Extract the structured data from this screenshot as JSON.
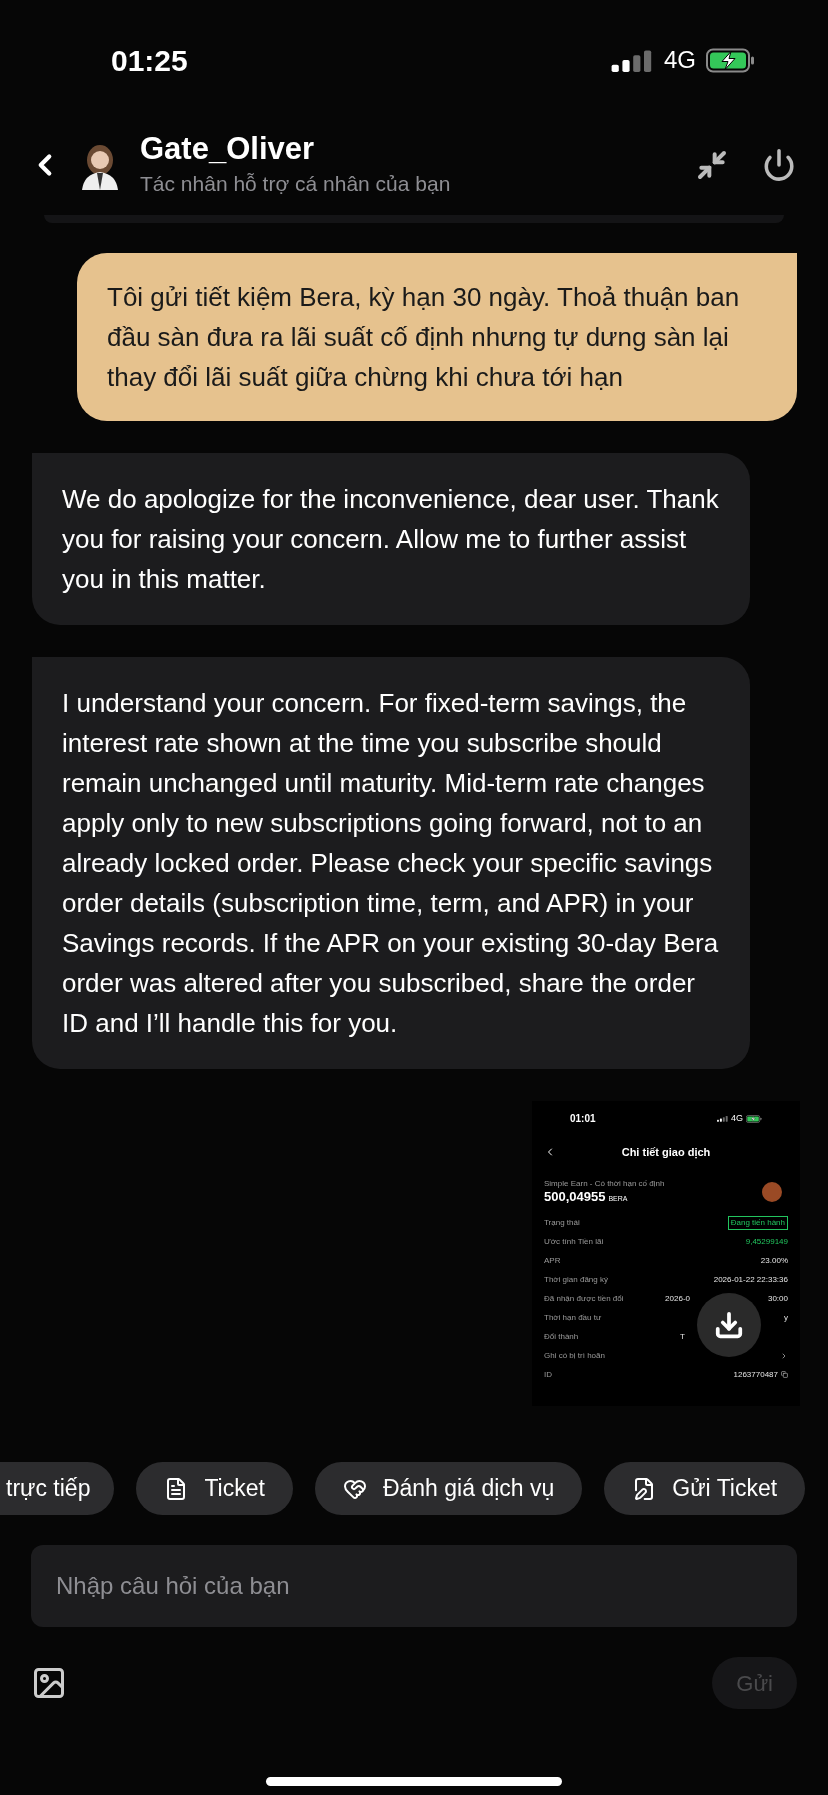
{
  "status_bar": {
    "time": "01:25",
    "network": "4G"
  },
  "header": {
    "title": "Gate_Oliver",
    "subtitle": "Tác nhân hỗ trợ cá nhân của bạn"
  },
  "messages": [
    {
      "kind": "user",
      "text": "Tôi gửi tiết kiệm Bera, kỳ hạn 30 ngày. Thoả thuận ban đầu sàn đưa ra lãi suất cố định nhưng tự dưng sàn lại thay đổi lãi suất giữa chừng khi chưa tới hạn"
    },
    {
      "kind": "bot",
      "text": "We do apologize for the inconvenience, dear user. Thank you for raising your concern. Allow me to further assist you in this matter."
    },
    {
      "kind": "bot",
      "text": "I understand your concern. For fixed-term savings, the interest rate shown at the time you subscribe should remain unchanged until maturity. Mid-term rate changes apply only to new subscriptions going forward, not to an already locked order. Please check your specific savings order details (subscription time, term, and APR) in your Savings records. If the APR on your existing 30-day Bera order was altered after you subscribed, share the order ID and I’ll handle this for you."
    },
    {
      "kind": "screenshot",
      "time": "01:01",
      "network": "4G",
      "title": "Chi tiết giao dịch",
      "product": "Simple Earn - Có thời hạn cố định",
      "amount": "500,04955",
      "unit": "BERA",
      "rows": [
        {
          "label": "Trạng thái",
          "value": "Đang tiến hành",
          "kind": "badge"
        },
        {
          "label": "Ước tính Tiền lãi",
          "value": "9,45299149",
          "kind": "green"
        },
        {
          "label": "APR",
          "value": "23.00%",
          "kind": "plain"
        },
        {
          "label": "Thời gian đăng ký",
          "value": "2026-01-22 22:33:36",
          "kind": "plain"
        },
        {
          "label": "Đã nhận được tiền đổi",
          "value": "2026-0",
          "value_end": "30:00",
          "kind": "plain"
        },
        {
          "label": "Thời hạn đầu tư",
          "value_end": "y",
          "kind": "plain"
        },
        {
          "label": "Đổi thành",
          "value": "T",
          "kind": "plain"
        },
        {
          "label": "Ghi có bị trì hoãn",
          "kind": "chevron"
        },
        {
          "label": "ID",
          "value": "1263770487",
          "kind": "copy"
        }
      ]
    }
  ],
  "quick_actions": [
    {
      "label": "trực tiếp"
    },
    {
      "label": "Ticket"
    },
    {
      "label": "Đánh giá dịch vụ"
    },
    {
      "label": "Gửi Ticket"
    }
  ],
  "input": {
    "placeholder": "Nhập câu hỏi của bạn"
  },
  "send_button": {
    "label": "Gửi",
    "disabled": true
  }
}
